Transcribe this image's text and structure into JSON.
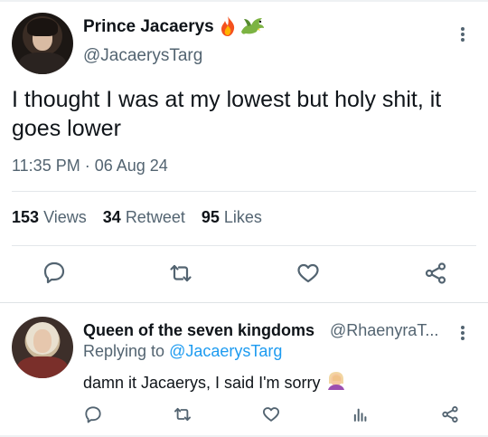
{
  "main_tweet": {
    "display_name": "Prince Jacaerys",
    "name_emoji": [
      "fire-icon",
      "dragon-icon"
    ],
    "handle": "@JacaerysTarg",
    "text": "I thought I was at my lowest but holy shit, it goes lower",
    "timestamp": "11:35 PM · 06 Aug 24",
    "stats": {
      "views_count": "153",
      "views_label": "Views",
      "retweet_count": "34",
      "retweet_label": "Retweet",
      "likes_count": "95",
      "likes_label": "Likes"
    },
    "actions": [
      "reply-icon",
      "retweet-icon",
      "like-icon",
      "share-icon"
    ]
  },
  "reply_tweet": {
    "display_name": "Queen of the seven kingdoms",
    "handle": "@RhaenyraT...",
    "replying_prefix": "Replying to",
    "replying_to": "@JacaerysTarg",
    "text": "damn it Jacaerys, I said I'm sorry",
    "text_emoji": "woman-facepalming-icon",
    "actions": [
      "reply-icon",
      "retweet-icon",
      "like-icon",
      "views-icon",
      "share-icon"
    ]
  },
  "colors": {
    "text": "#0f1419",
    "muted": "#536471",
    "link": "#1d9bf0",
    "divider": "#e3e7ea"
  }
}
